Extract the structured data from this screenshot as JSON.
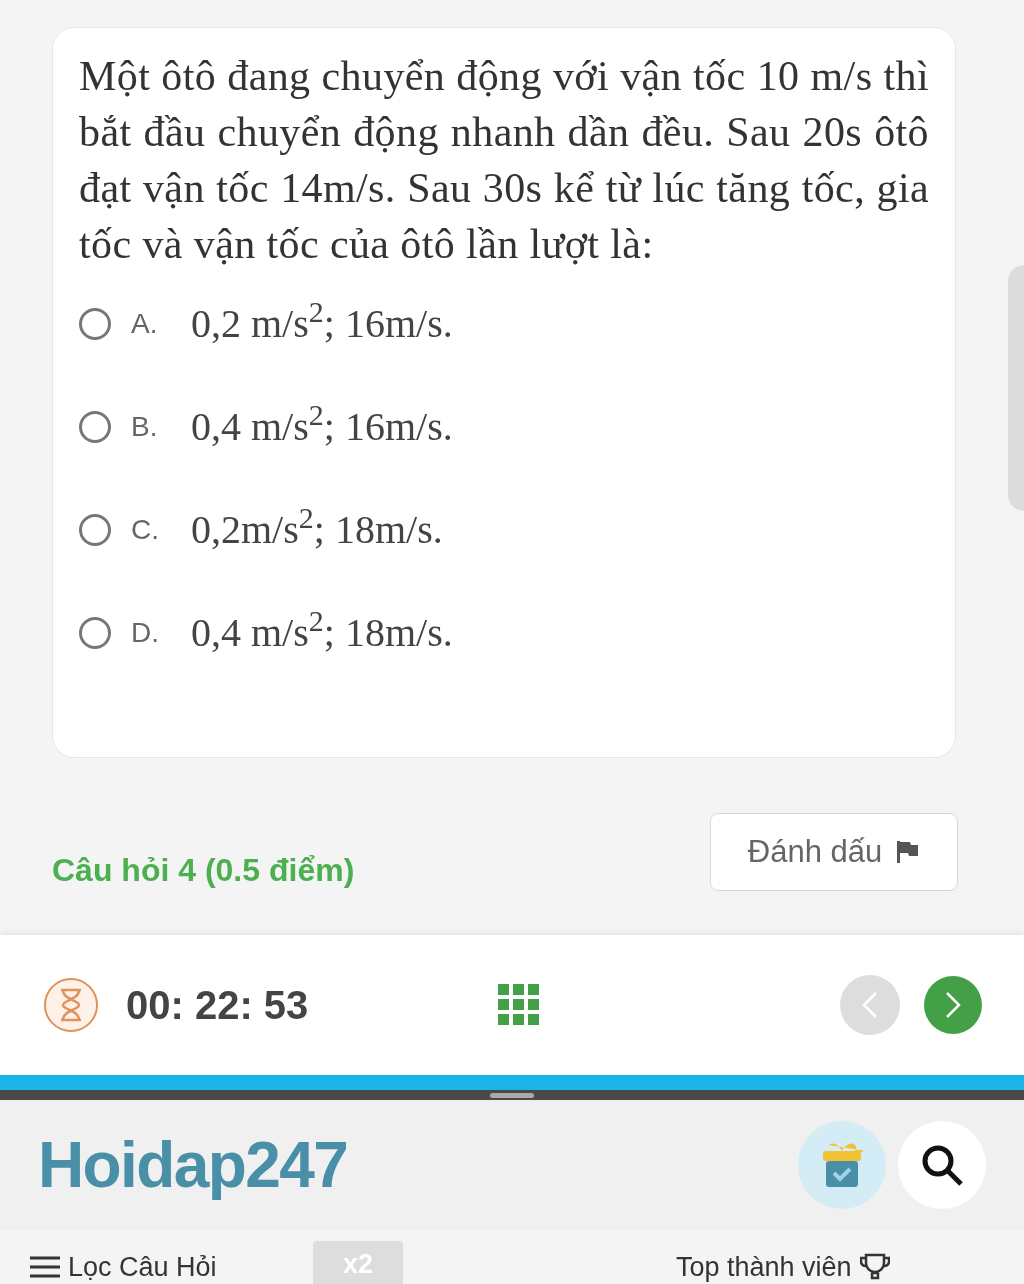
{
  "question": {
    "text": "Một ôtô đang chuyển động với vận tốc 10 m/s thì bắt đầu chuyển động nhanh dần đều. Sau 20s ôtô đạt vận tốc 14m/s. Sau 30s kể từ lúc tăng tốc, gia tốc và vận tốc của ôtô lần lượt là:",
    "options": [
      {
        "letter": "A.",
        "text": "0,2 m/s$^{2}$; 16m/s.",
        "selected": false
      },
      {
        "letter": "B.",
        "text": "0,4 m/s$^{2}$; 16m/s.",
        "selected": false
      },
      {
        "letter": "C.",
        "text": "0,2m/s$^{2}$; 18m/s.",
        "selected": false
      },
      {
        "letter": "D.",
        "text": "0,4 m/s$^{2}$; 18m/s.",
        "selected": false
      }
    ]
  },
  "mark_button": {
    "label": "Đánh dấu"
  },
  "next_question": {
    "title": "Câu hỏi 4 (0.5 điểm)"
  },
  "timer_bar": {
    "time": "00: 22: 53",
    "prev_disabled": true,
    "next_disabled": false
  },
  "header": {
    "logo": "Hoidap247"
  },
  "nav": {
    "filter": "Lọc Câu Hỏi",
    "badge": "x2",
    "top": "Top thành viên"
  }
}
